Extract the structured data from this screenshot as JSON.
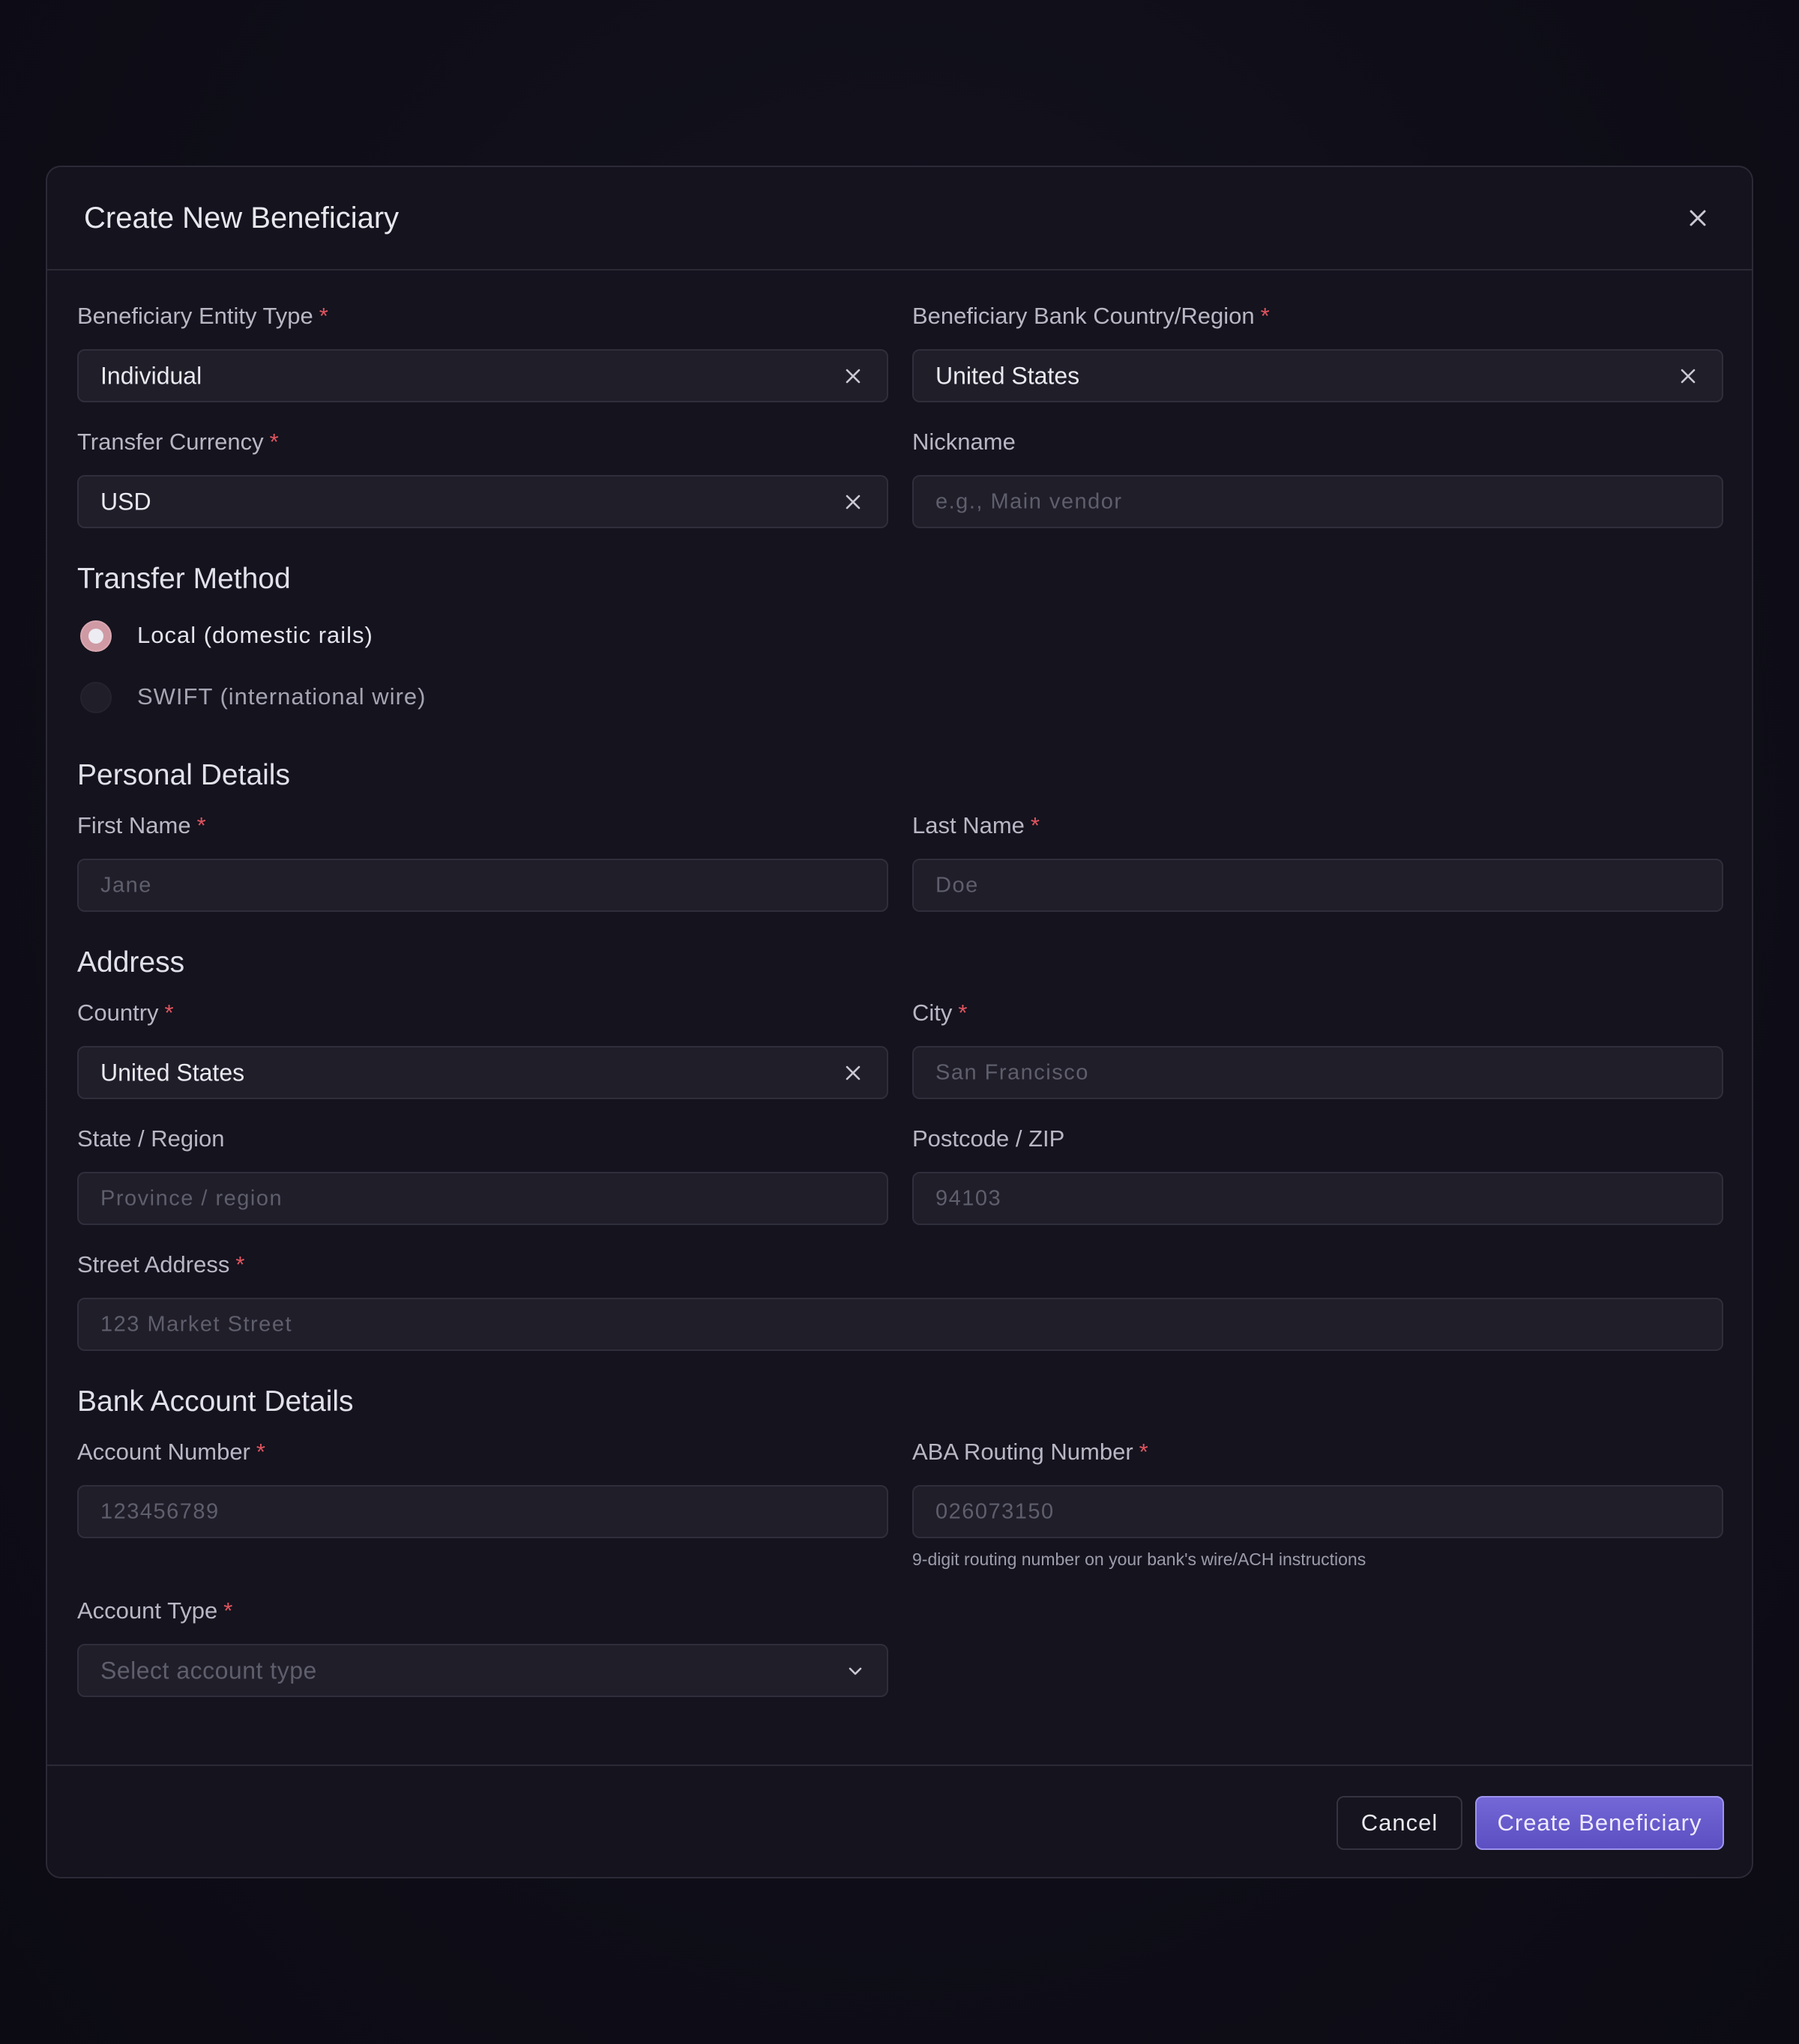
{
  "modal": {
    "title": "Create New Beneficiary",
    "close_icon": "close-icon"
  },
  "required_marker": "*",
  "entity_type": {
    "label": "Beneficiary Entity Type",
    "value": "Individual"
  },
  "bank_country": {
    "label": "Beneficiary Bank Country/Region",
    "value": "United States"
  },
  "currency": {
    "label": "Transfer Currency",
    "value": "USD"
  },
  "nickname": {
    "label": "Nickname",
    "placeholder": "e.g., Main vendor"
  },
  "transfer_method": {
    "title": "Transfer Method",
    "options": [
      {
        "label": "Local (domestic rails)",
        "selected": true
      },
      {
        "label": "SWIFT (international wire)",
        "selected": false
      }
    ]
  },
  "personal": {
    "title": "Personal Details",
    "first_name": {
      "label": "First Name",
      "placeholder": "Jane"
    },
    "last_name": {
      "label": "Last Name",
      "placeholder": "Doe"
    }
  },
  "address": {
    "title": "Address",
    "country": {
      "label": "Country",
      "value": "United States"
    },
    "city": {
      "label": "City",
      "placeholder": "San Francisco"
    },
    "state": {
      "label": "State / Region",
      "placeholder": "Province / region"
    },
    "postcode": {
      "label": "Postcode / ZIP",
      "placeholder": "94103"
    },
    "street": {
      "label": "Street Address",
      "placeholder": "123 Market Street"
    }
  },
  "bank": {
    "title": "Bank Account Details",
    "account_number": {
      "label": "Account Number",
      "placeholder": "123456789"
    },
    "routing_number": {
      "label": "ABA Routing Number",
      "placeholder": "026073150",
      "hint": "9-digit routing number on your bank's wire/ACH instructions"
    },
    "account_type": {
      "label": "Account Type",
      "placeholder": "Select account type"
    }
  },
  "footer": {
    "cancel_label": "Cancel",
    "create_label": "Create Beneficiary"
  },
  "colors": {
    "background": "#0f0e18",
    "modal": "#14131e",
    "required": "#e0555f",
    "primary": "#6a5dd0"
  }
}
